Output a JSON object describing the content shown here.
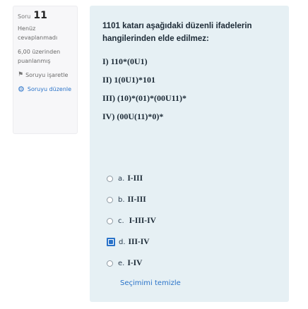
{
  "question_info": {
    "label": "Soru",
    "number": "11",
    "status": "Henüz cevaplanmadı",
    "score": "6,00 üzerinden puanlanmış",
    "flag_label": "Soruyu işaretle",
    "edit_label": "Soruyu düzenle"
  },
  "question": {
    "text_line1": "1101 katarı aşağıdaki düzenli ifadelerin",
    "text_line2": "hangilerinden elde edilmez:",
    "expressions": [
      "I) 110*(0U1)",
      "II) 1(0U1)*101",
      "III) (10)*(01)*(00U11)*",
      "IV) (00U(11)*0)*"
    ]
  },
  "options": [
    {
      "letter": "a.",
      "text": "I-III",
      "checked": false
    },
    {
      "letter": "b.",
      "text": "II-III",
      "checked": false
    },
    {
      "letter": "c.",
      "text": " I-III-IV",
      "checked": false
    },
    {
      "letter": "d.",
      "text": "III-IV",
      "checked": true
    },
    {
      "letter": "e.",
      "text": "I-IV",
      "checked": false
    }
  ],
  "clear_choice": "Seçimimi temizle",
  "colors": {
    "accent": "#2a73c9",
    "card_bg": "#e6f0f4"
  }
}
